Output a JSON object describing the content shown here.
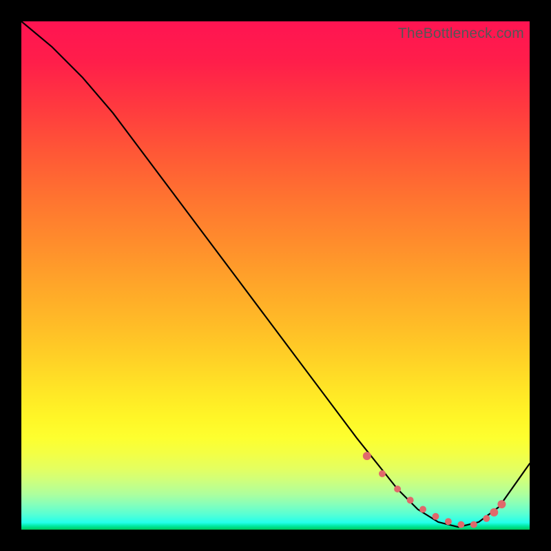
{
  "watermark": "TheBottleneck.com",
  "chart_data": {
    "type": "line",
    "title": "",
    "xlabel": "",
    "ylabel": "",
    "xlim": [
      0,
      100
    ],
    "ylim": [
      0,
      100
    ],
    "series": [
      {
        "name": "curve",
        "x": [
          0,
          6,
          12,
          18,
          24,
          30,
          36,
          42,
          48,
          54,
          60,
          66,
          70,
          74,
          78,
          82,
          86,
          90,
          94,
          100
        ],
        "values": [
          100,
          95,
          89,
          82,
          74,
          66,
          58,
          50,
          42,
          34,
          26,
          18,
          13,
          8,
          4,
          1.5,
          0.5,
          1.5,
          4.5,
          13
        ]
      }
    ],
    "markers": {
      "name": "highlight-points",
      "color": "#e0696b",
      "x": [
        68,
        71,
        74,
        76.5,
        79,
        81.5,
        84,
        86.5,
        89,
        91.5,
        93,
        94.5
      ],
      "values": [
        14.5,
        11,
        8,
        5.8,
        4,
        2.6,
        1.6,
        1.0,
        1.0,
        2.2,
        3.4,
        5.0
      ]
    }
  }
}
